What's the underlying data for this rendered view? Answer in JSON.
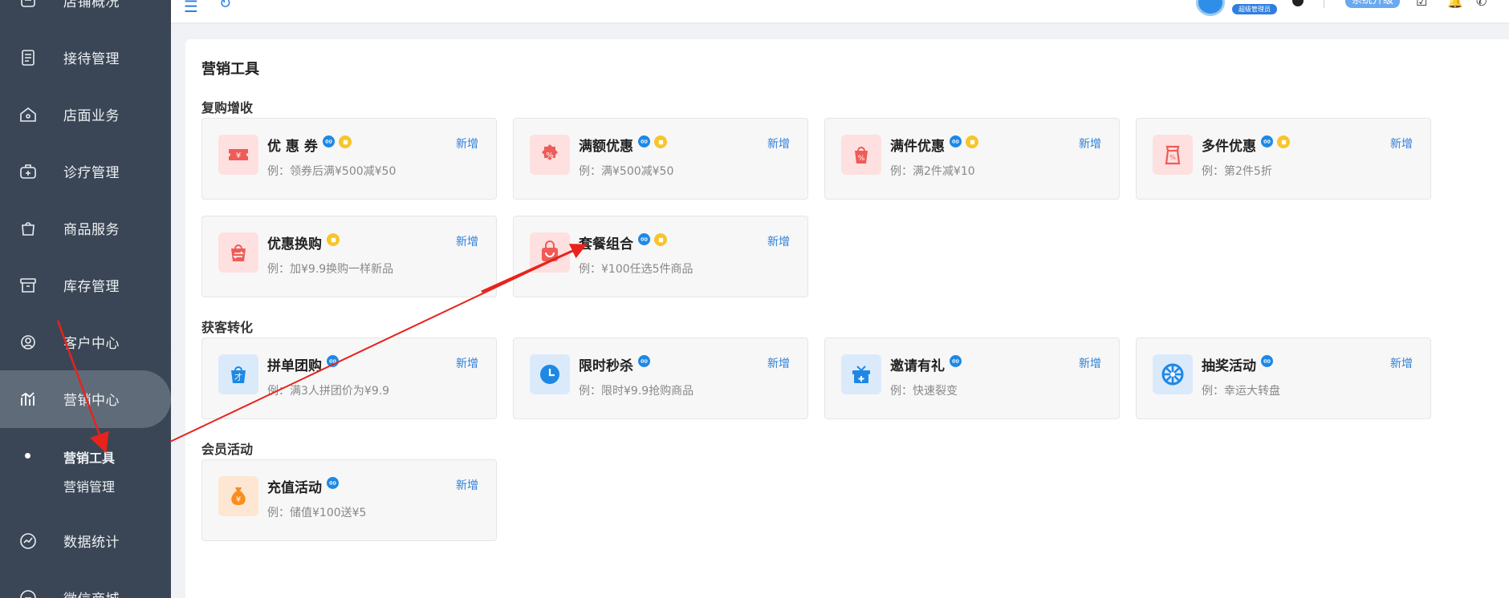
{
  "sidebar": {
    "items": [
      {
        "label": "店铺概况",
        "icon": "store-overview-icon"
      },
      {
        "label": "接待管理",
        "icon": "reception-icon"
      },
      {
        "label": "店面业务",
        "icon": "storefront-icon"
      },
      {
        "label": "诊疗管理",
        "icon": "medical-kit-icon"
      },
      {
        "label": "商品服务",
        "icon": "shopping-bag-icon"
      },
      {
        "label": "库存管理",
        "icon": "inventory-box-icon"
      },
      {
        "label": "客户中心",
        "icon": "customer-icon"
      },
      {
        "label": "营销中心",
        "icon": "marketing-chart-icon"
      },
      {
        "label": "数据统计",
        "icon": "statistics-icon"
      },
      {
        "label": "微信商城",
        "icon": "wechat-mall-icon"
      }
    ],
    "sub_items": [
      {
        "label": "营销工具",
        "active": true
      },
      {
        "label": "营销管理",
        "active": false
      }
    ]
  },
  "topbar": {
    "role_badge": "超级管理员",
    "upgrade_label": "系统升级"
  },
  "page": {
    "title": "营销工具",
    "add_label": "新增",
    "sections": [
      {
        "title": "复购增收",
        "tools": [
          {
            "name": "优 惠 券",
            "desc": "例：领券后满¥500减¥50",
            "icon": "coupon-icon",
            "mini_program": true,
            "paid": true,
            "color": "#f05b56"
          },
          {
            "name": "满额优惠",
            "desc": "例：满¥500减¥50",
            "icon": "percent-badge-icon",
            "mini_program": true,
            "paid": true,
            "color": "#f05b56"
          },
          {
            "name": "满件优惠",
            "desc": "例：满2件减¥10",
            "icon": "discount-bag-icon",
            "mini_program": true,
            "paid": true,
            "color": "#f05b56"
          },
          {
            "name": "多件优惠",
            "desc": "例：第2件5折",
            "icon": "multi-item-discount-icon",
            "mini_program": true,
            "paid": true,
            "color": "#f05b56"
          },
          {
            "name": "优惠换购",
            "desc": "例：加¥9.9换购一样新品",
            "icon": "exchange-bag-icon",
            "mini_program": false,
            "paid": true,
            "color": "#f05b56"
          },
          {
            "name": "套餐组合",
            "desc": "例：¥100任选5件商品",
            "icon": "package-bag-icon",
            "mini_program": true,
            "paid": true,
            "color": "#f05b56"
          }
        ]
      },
      {
        "title": "获客转化",
        "tools": [
          {
            "name": "拼单团购",
            "desc": "例：满3人拼团价为¥9.9",
            "icon": "group-buy-icon",
            "mini_program": true,
            "paid": false,
            "color": "#1e88e5"
          },
          {
            "name": "限时秒杀",
            "desc": "例：限时¥9.9抢购商品",
            "icon": "clock-icon",
            "mini_program": true,
            "paid": false,
            "color": "#1e88e5"
          },
          {
            "name": "邀请有礼",
            "desc": "例：快速裂变",
            "icon": "gift-icon",
            "mini_program": true,
            "paid": false,
            "color": "#1e88e5"
          },
          {
            "name": "抽奖活动",
            "desc": "例：幸运大转盘",
            "icon": "lucky-wheel-icon",
            "mini_program": true,
            "paid": false,
            "color": "#1e88e5"
          }
        ]
      },
      {
        "title": "会员活动",
        "tools": [
          {
            "name": "充值活动",
            "desc": "例：储值¥100送¥5",
            "icon": "money-bag-icon",
            "mini_program": true,
            "paid": false,
            "color": "#fb8c1e"
          }
        ]
      }
    ]
  },
  "annotation": {
    "color": "#e8231c"
  }
}
